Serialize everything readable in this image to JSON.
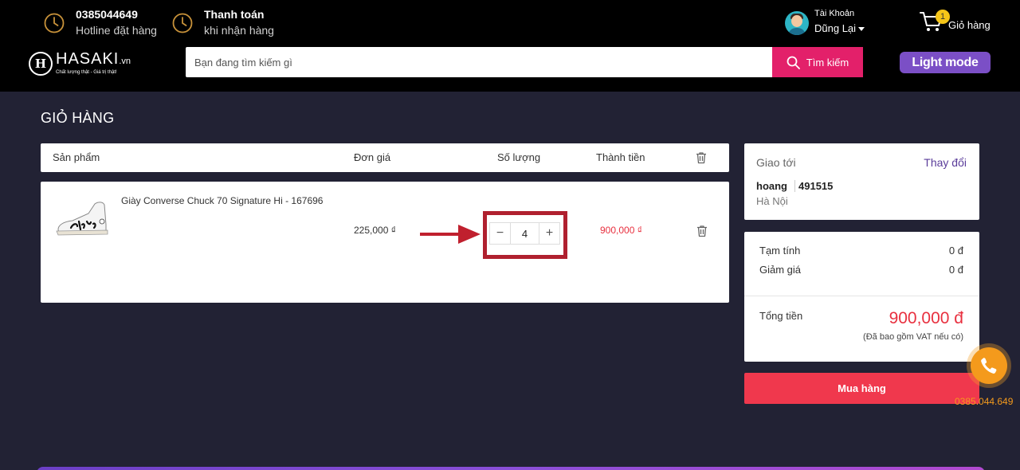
{
  "header": {
    "hotline": {
      "number": "0385044649",
      "label": "Hotline đặt hàng"
    },
    "payment": {
      "title": "Thanh toán",
      "subtitle": "khi nhận hàng"
    },
    "account": {
      "label": "Tài Khoản",
      "name": "Dũng Lại"
    },
    "cart": {
      "count": "1",
      "label": "Giỏ hàng"
    },
    "logo": {
      "name": "HASAKI",
      "suffix": ".vn",
      "tagline": "Chất lượng thật - Giá trị thật!"
    },
    "search": {
      "placeholder": "Bạn đang tìm kiếm gì",
      "button_label": "Tìm kiếm"
    },
    "theme_button": "Light mode"
  },
  "page": {
    "title": "GIỎ HÀNG"
  },
  "table": {
    "headers": {
      "product": "Sản phẩm",
      "unit_price": "Đơn giá",
      "quantity": "Số lượng",
      "total": "Thành tiền"
    },
    "rows": [
      {
        "name": "Giày Converse Chuck 70 Signature Hi - 167696",
        "unit_price": "225,000 ₫",
        "quantity": "4",
        "total": "900,000 ₫"
      }
    ]
  },
  "shipping": {
    "title": "Giao tới",
    "change_label": "Thay đổi",
    "name": "hoang",
    "phone": "491515",
    "city": "Hà Nội"
  },
  "summary": {
    "subtotal_label": "Tạm tính",
    "subtotal_value": "0 đ",
    "discount_label": "Giảm giá",
    "discount_value": "0 đ",
    "total_label": "Tổng tiền",
    "total_value": "900,000 đ",
    "vat_note": "(Đã bao gồm VAT nếu có)"
  },
  "buy_button": "Mua hàng",
  "call": {
    "number": "0385.044.649"
  },
  "colors": {
    "accent_pink": "#e3206a",
    "price_red": "#e8303f",
    "buy_red": "#f0384d",
    "purple": "#7b4fc6"
  }
}
